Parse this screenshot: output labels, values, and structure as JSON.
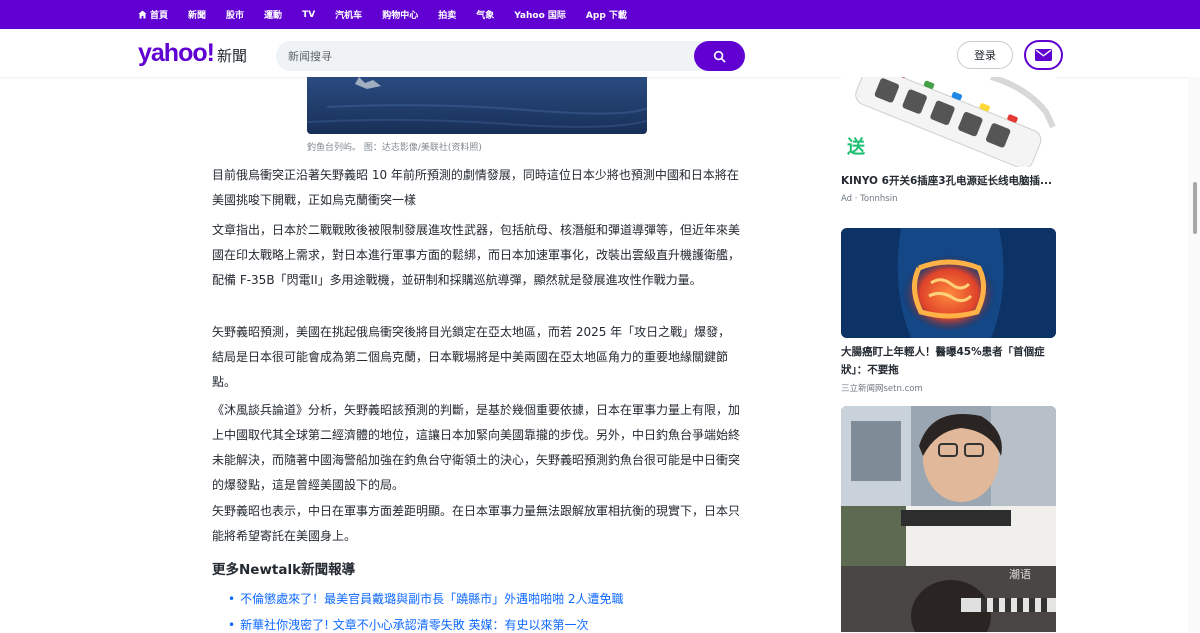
{
  "topnav": {
    "items": [
      {
        "label": "首頁",
        "icon": "home-icon"
      },
      {
        "label": "新聞"
      },
      {
        "label": "股市"
      },
      {
        "label": "運動"
      },
      {
        "label": "TV"
      },
      {
        "label": "汽机车"
      },
      {
        "label": "购物中心"
      },
      {
        "label": "拍卖"
      },
      {
        "label": "气象"
      },
      {
        "label": "Yahoo 国际"
      },
      {
        "label": "App 下載"
      }
    ]
  },
  "header": {
    "logo_brand": "yahoo!",
    "logo_section": "新聞",
    "search_placeholder": "新闻搜寻",
    "login_label": "登录"
  },
  "article": {
    "caption": "釣鱼台列屿。 图：达志影像/美联社(资料照)",
    "paragraphs": [
      "目前俄烏衝突正沿著矢野義昭 10 年前所預測的劇情發展，同時這位日本少將也預測中國和日本將在美國挑唆下開戰，正如烏克蘭衝突一樣",
      "文章指出，日本於二戰戰敗後被限制發展進攻性武器，包括航母、核潛艇和彈道導彈等，但近年來美國在印太戰略上需求，對日本進行軍事方面的鬆綁，而日本加速軍事化，改裝出雲級直升機護衛艦，配備 F-35B「閃電II」多用途戰機，並研制和採購巡航導彈，顯然就是發展進攻性作戰力量。",
      "矢野義昭預測，美國在挑起俄烏衝突後將目光鎖定在亞太地區，而若 2025 年「攻日之戰」爆發，結局是日本很可能會成為第二個烏克蘭，日本戰場將是中美兩國在亞太地區角力的重要地緣關鍵節點。",
      "《沐風談兵論道》分析，矢野義昭該預測的判斷，是基於幾個重要依據，日本在軍事力量上有限，加上中國取代其全球第二經濟體的地位，這讓日本加緊向美國靠攏的步伐。另外，中日釣魚台爭端始終未能解決，而隨著中國海警船加強在釣魚台守衛領土的決心，矢野義昭預測釣魚台很可能是中日衝突的爆發點，這是曾經美國設下的局。",
      "矢野義昭也表示，中日在軍事方面差距明顯。在日本軍事力量無法跟解放軍相抗衡的現實下，日本只能將希望寄託在美國身上。"
    ],
    "more_title": "更多Newtalk新聞報導",
    "more_links": [
      "不倫懲處來了！最美官員戴璐與副市長「蹺縣市」外遇啪啪啪 2人遭免職",
      "新華社你洩密了! 文章不小心承認清零失敗 英媒：有史以來第一次"
    ]
  },
  "sidebar": {
    "ads": [
      {
        "title": "KINYO 6开关6插座3孔电源延长线电脑插...",
        "source": "Ad · Tonnhsin",
        "badge": "送"
      },
      {
        "title": "大腸癌盯上年輕人！醫曝45%患者「首個症狀」：不要拖",
        "source": "三立新闻网setn.com"
      },
      {
        "overlay": "潮语"
      }
    ]
  },
  "colors": {
    "brand": "#6001d2",
    "link": "#0f69ff",
    "text": "#232a31",
    "muted": "#828a93"
  }
}
